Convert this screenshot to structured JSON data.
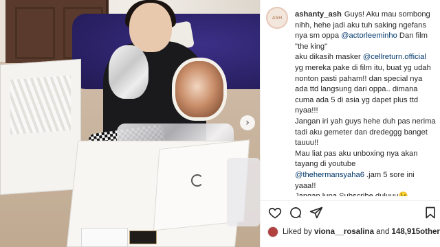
{
  "post": {
    "username": "ashanty_ash",
    "avatar_text": "ASH",
    "caption_lines": [
      "Guys! Aku mau sombong nihh, hehe jadi aku tuh saking ngefans nya sm oppa ",
      "@actorleeminho",
      " Dan film \"the king\"\naku dikasih masker ",
      "@cellreturn.official",
      "\nyg mereka pake di film itu, buat yg udah nonton pasti paham!! dan special nya ada ttd langsung dari oppa.. dimana cuma ada 5 di asia yg dapet plus ttd nyaa!!!\nJangan iri yah guys hehe duh pas nerima tadi aku gemeter dan dredeggg banget tauuu!!\nMau liat pas aku unboxing nya akan tayang di youtube\n",
      "@thehermansyaha6",
      " .jam 5 sore ini yaaa!!\nJangan lupa Subscribe duluuu😉"
    ],
    "likes": {
      "prefix": "Liked by ",
      "user": "viona__rosalina",
      "middle": " and ",
      "count": "148,915",
      "suffix": " others"
    }
  },
  "icons": {
    "like": "heart-icon",
    "comment": "comment-icon",
    "share": "paper-plane-icon",
    "save": "bookmark-icon",
    "next": "chevron-right-icon"
  },
  "colors": {
    "text": "#262626",
    "mention": "#00376b",
    "border": "#efefef"
  }
}
